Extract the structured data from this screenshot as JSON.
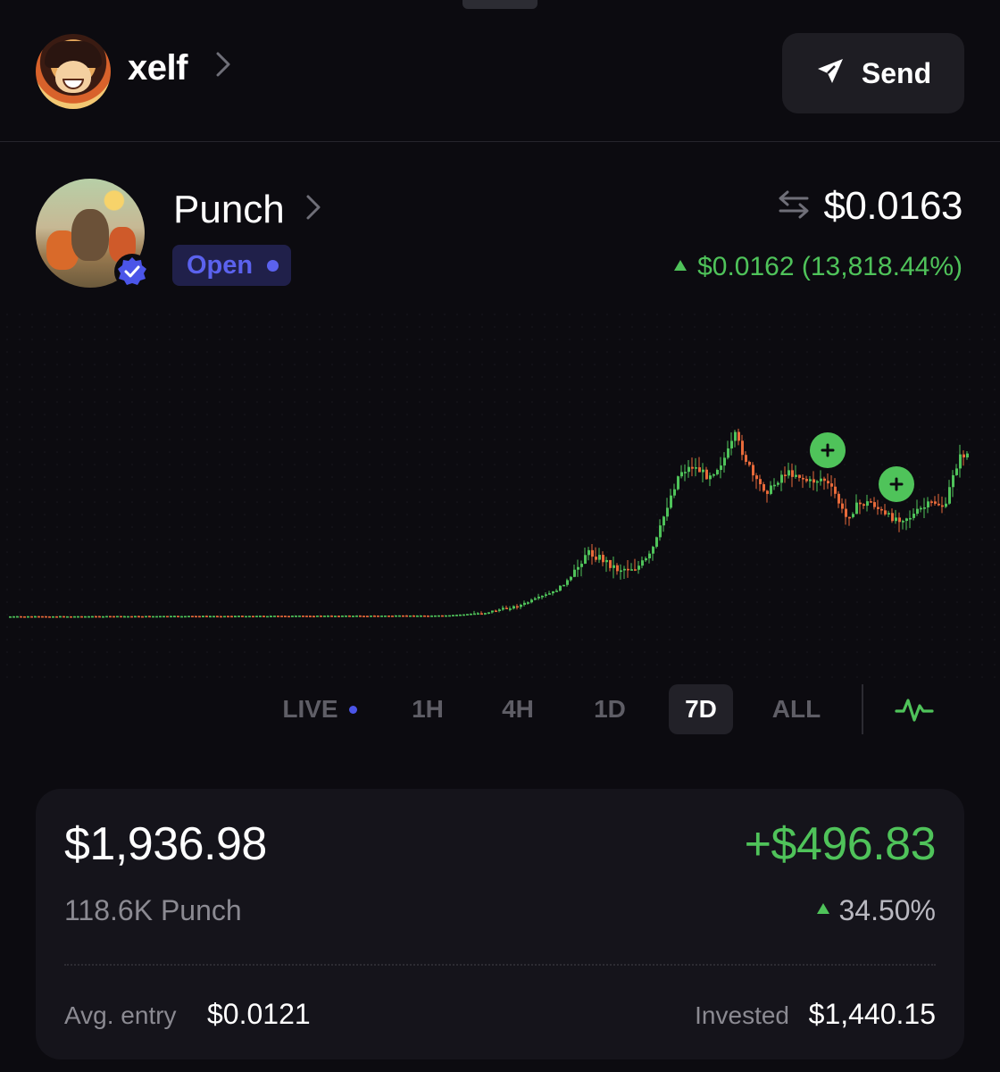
{
  "header": {
    "username": "xelf",
    "send_label": "Send"
  },
  "token": {
    "name": "Punch",
    "status": "Open",
    "price": "$0.0163",
    "change": "$0.0162 (13,818.44%)"
  },
  "chart": {
    "timeframes": [
      "LIVE",
      "1H",
      "4H",
      "1D",
      "7D",
      "ALL"
    ],
    "active_timeframe": "7D"
  },
  "holdings": {
    "value": "$1,936.98",
    "pnl": "+$496.83",
    "amount": "118.6K Punch",
    "pnl_percent": "34.50%",
    "avg_entry_label": "Avg. entry",
    "avg_entry_value": "$0.0121",
    "invested_label": "Invested",
    "invested_value": "$1,440.15"
  },
  "colors": {
    "up": "#4fc35a",
    "down": "#e86a3a",
    "accent": "#5b62ee",
    "background": "#0c0b10"
  },
  "icons": {
    "send": "paper-plane-icon",
    "swap": "swap-arrows-icon",
    "verified": "verified-badge-icon",
    "chart_type": "line-chart-icon"
  }
}
